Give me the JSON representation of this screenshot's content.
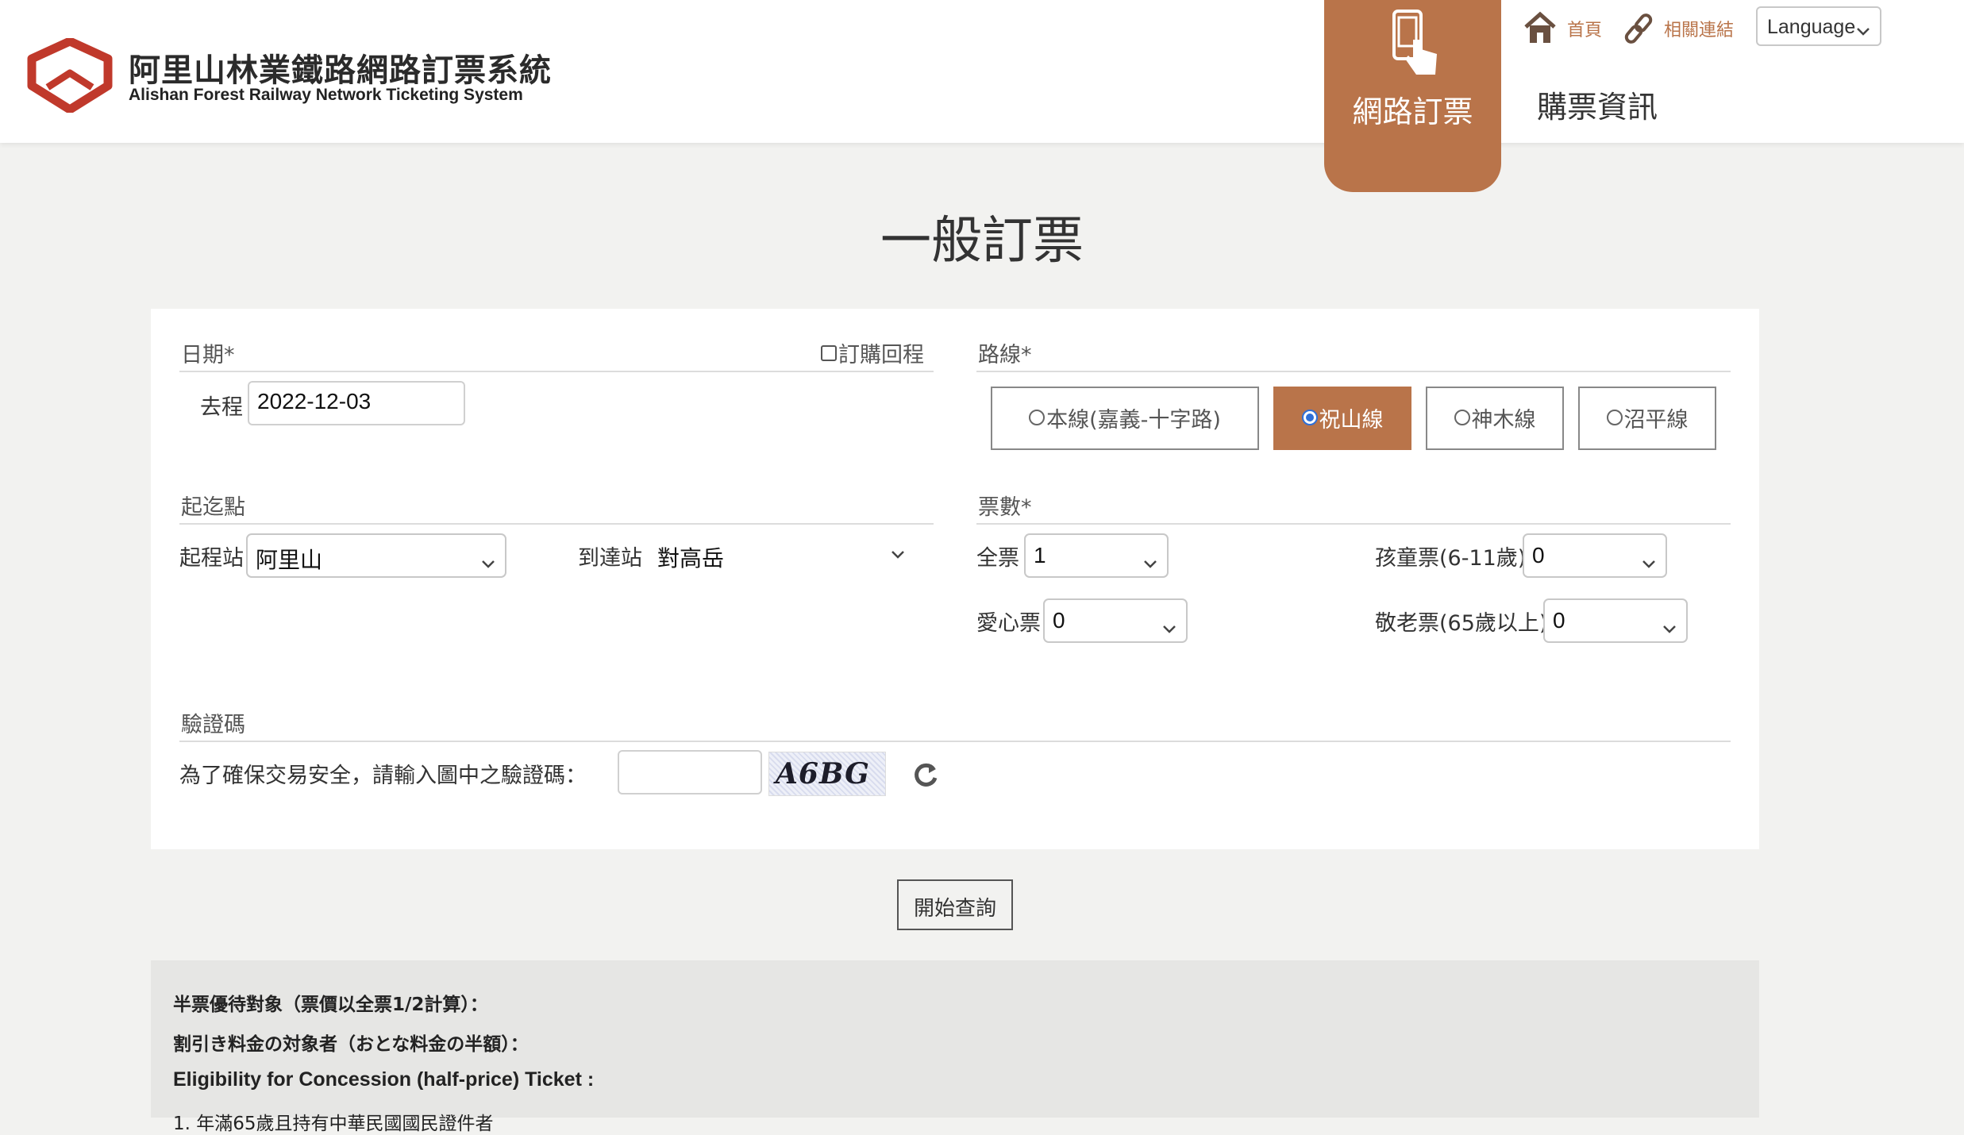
{
  "header": {
    "logo_zh": "阿里山林業鐵路網路訂票系統",
    "logo_en": "Alishan Forest Railway Network Ticketing System",
    "tab_online": "網路訂票",
    "tab_info": "購票資訊",
    "link_home": "首頁",
    "link_related": "相關連結",
    "language": "Language"
  },
  "page": {
    "title": "一般訂票"
  },
  "date_section": {
    "label": "日期*",
    "return_trip": "訂購回程",
    "outbound_label": "去程",
    "outbound_value": "2022-12-03"
  },
  "route_section": {
    "label": "路線*",
    "options": [
      "本線(嘉義-十字路)",
      "祝山線",
      "神木線",
      "沼平線"
    ],
    "selected_index": 1
  },
  "station_section": {
    "label": "起迄點",
    "from_label": "起程站",
    "from_value": "阿里山",
    "to_label": "到達站",
    "to_value": "對高岳"
  },
  "ticket_section": {
    "label": "票數*",
    "full_label": "全票",
    "full_value": "1",
    "child_label": "孩童票(6-11歲)",
    "child_value": "0",
    "care_label": "愛心票",
    "care_value": "0",
    "senior_label": "敬老票(65歲以上)",
    "senior_value": "0"
  },
  "captcha_section": {
    "label": "驗證碼",
    "prompt": "為了確保交易安全，請輸入圖中之驗證碼：",
    "input_value": "",
    "image_text": "A6BG"
  },
  "actions": {
    "search": "開始查詢"
  },
  "notes": {
    "line1": "半票優待對象（票價以全票1/2計算）：",
    "line2": "割引き料金の対象者（おとな料金の半額）：",
    "line3": "Eligibility for Concession (half-price) Ticket :",
    "line4": "1. 年滿65歲且持有中華民國國民證件者"
  },
  "colors": {
    "accent": "#b9744a",
    "brand_red": "#c0392b",
    "background": "#f2f2f0"
  },
  "icons": [
    "logo-mark",
    "phone-touch-icon",
    "home-icon",
    "link-icon",
    "chevron-down-icon",
    "refresh-icon"
  ]
}
